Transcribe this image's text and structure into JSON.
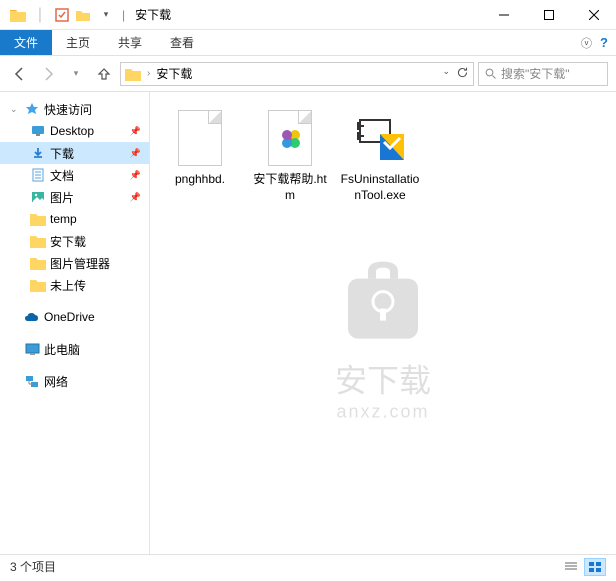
{
  "window": {
    "title": "安下载",
    "separator": "|"
  },
  "ribbon": {
    "file": "文件",
    "tabs": [
      "主页",
      "共享",
      "查看"
    ]
  },
  "address": {
    "folder": "安下载",
    "search_placeholder": "搜索\"安下载\""
  },
  "sidebar": {
    "quick_access": "快速访问",
    "items": [
      {
        "label": "Desktop",
        "icon": "desktop",
        "pinned": true
      },
      {
        "label": "下载",
        "icon": "download",
        "pinned": true,
        "selected": true
      },
      {
        "label": "文档",
        "icon": "document",
        "pinned": true
      },
      {
        "label": "图片",
        "icon": "picture",
        "pinned": true
      },
      {
        "label": "temp",
        "icon": "folder",
        "pinned": false
      },
      {
        "label": "安下载",
        "icon": "folder",
        "pinned": false
      },
      {
        "label": "图片管理器",
        "icon": "folder",
        "pinned": false
      },
      {
        "label": "未上传",
        "icon": "folder",
        "pinned": false
      }
    ],
    "onedrive": "OneDrive",
    "thispc": "此电脑",
    "network": "网络"
  },
  "files": [
    {
      "name": "pnghhbd.",
      "type": "blank"
    },
    {
      "name": "安下载帮助.htm",
      "type": "htm"
    },
    {
      "name": "FsUninstallationTool.exe",
      "type": "exe"
    }
  ],
  "watermark": {
    "line1": "安下载",
    "line2": "anxz.com"
  },
  "status": {
    "text": "3 个项目"
  }
}
